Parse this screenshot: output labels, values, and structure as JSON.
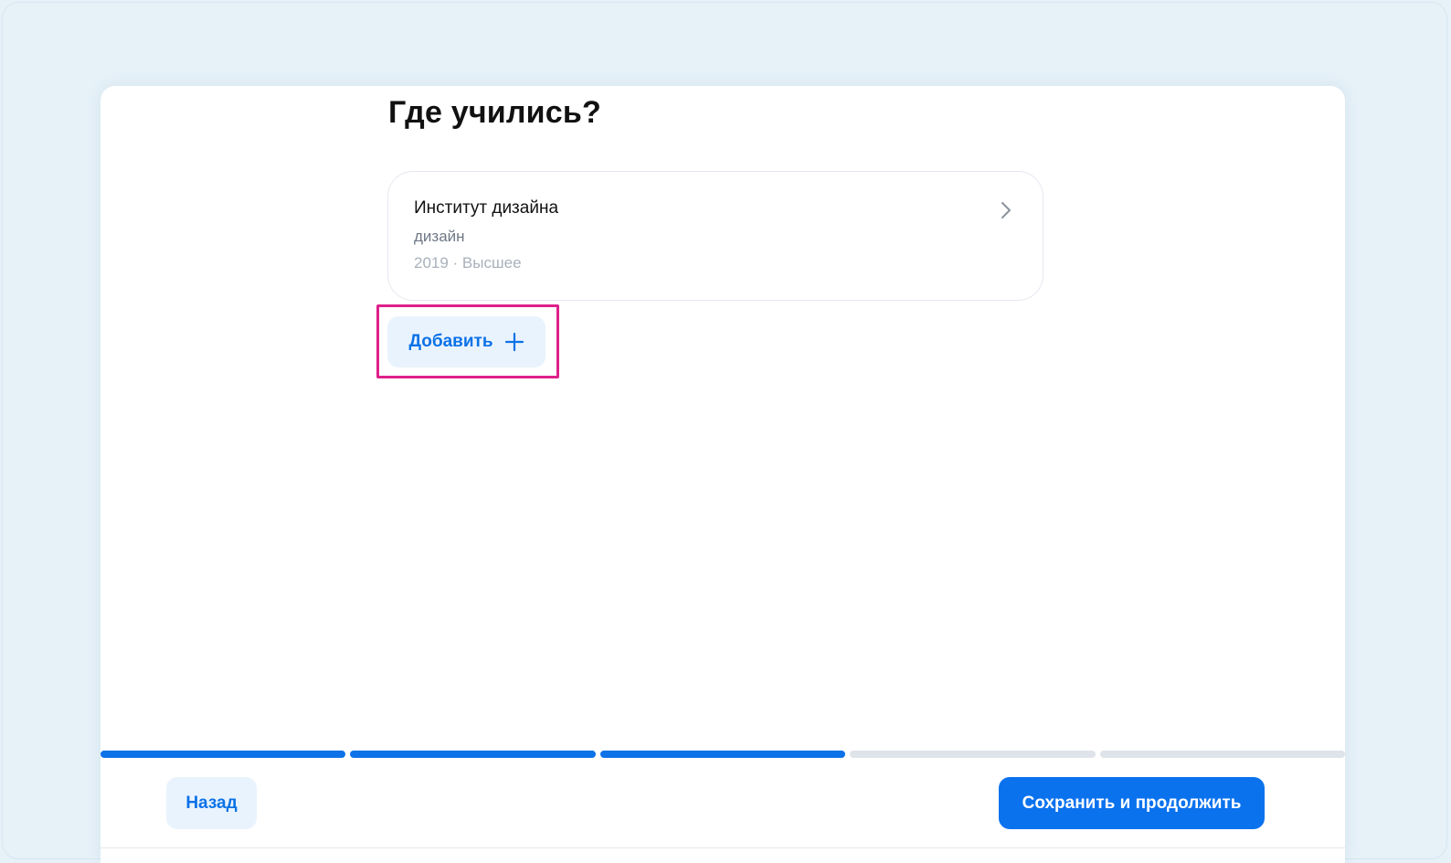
{
  "page": {
    "title": "Где учились?"
  },
  "education": {
    "items": [
      {
        "name": "Институт дизайна",
        "field": "дизайн",
        "meta": "2019 · Высшее",
        "icon": "chevron-right-icon"
      }
    ],
    "add_label": "Добавить",
    "add_icon": "plus-icon"
  },
  "progress": {
    "total_steps": 5,
    "completed_steps": 3
  },
  "footer": {
    "back_label": "Назад",
    "save_label": "Сохранить и продолжить"
  },
  "colors": {
    "accent": "#0b72ee",
    "accent_light": "#e9f3fd",
    "highlight": "#e0208a",
    "progress_inactive": "#dfe4ea"
  }
}
